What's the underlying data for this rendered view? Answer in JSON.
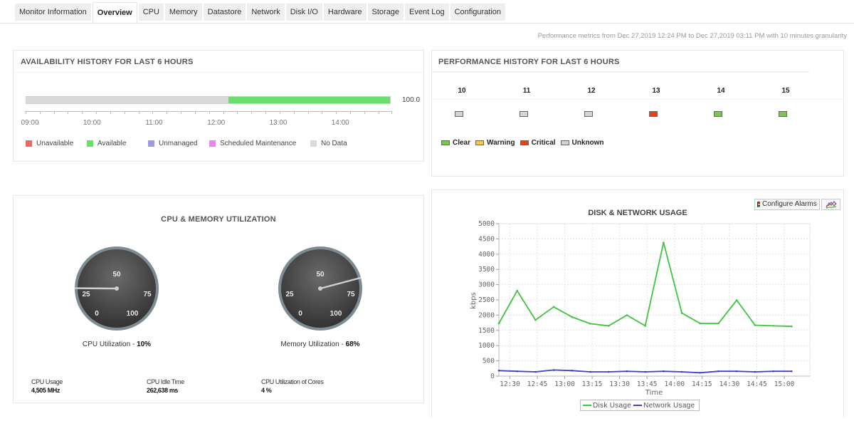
{
  "tabs": [
    {
      "label": "Monitor Information",
      "active": false
    },
    {
      "label": "Overview",
      "active": true
    },
    {
      "label": "CPU",
      "active": false
    },
    {
      "label": "Memory",
      "active": false
    },
    {
      "label": "Datastore",
      "active": false
    },
    {
      "label": "Network",
      "active": false
    },
    {
      "label": "Disk I/O",
      "active": false
    },
    {
      "label": "Hardware",
      "active": false
    },
    {
      "label": "Storage",
      "active": false
    },
    {
      "label": "Event Log",
      "active": false
    },
    {
      "label": "Configuration",
      "active": false
    }
  ],
  "perf_note": "Performance metrics from Dec 27,2019 12:24 PM to Dec 27,2019 03:11 PM with 10 minutes granularity",
  "availability": {
    "title": "AVAILABILITY HISTORY FOR LAST 6 HOURS",
    "value_label": "100.0",
    "segments": [
      {
        "status": "No Data",
        "start": "09:00",
        "end": "12:16"
      },
      {
        "status": "Available",
        "start": "12:16",
        "end": "14:53"
      }
    ],
    "range_hours": [
      9.0,
      14.88
    ],
    "axis_labels": [
      "09:00",
      "10:00",
      "11:00",
      "12:00",
      "13:00",
      "14:00"
    ],
    "legend": [
      {
        "label": "Unavailable",
        "color": "#e86a6a"
      },
      {
        "label": "Available",
        "color": "#6ae06a"
      },
      {
        "label": "Unmanaged",
        "color": "#9b9be0"
      },
      {
        "label": "Scheduled Maintenance",
        "color": "#e888e8"
      },
      {
        "label": "No Data",
        "color": "#dadada"
      }
    ]
  },
  "performance": {
    "title": "PERFORMANCE HISTORY FOR LAST 6 HOURS",
    "hours": [
      {
        "hour": "10",
        "status": "Unknown"
      },
      {
        "hour": "11",
        "status": "Unknown"
      },
      {
        "hour": "12",
        "status": "Unknown"
      },
      {
        "hour": "13",
        "status": "Critical"
      },
      {
        "hour": "14",
        "status": "Clear"
      },
      {
        "hour": "15",
        "status": "Clear"
      }
    ],
    "legend": [
      {
        "label": "Clear",
        "color": "#7ac74f"
      },
      {
        "label": "Warning",
        "color": "#f5c84c"
      },
      {
        "label": "Critical",
        "color": "#e8401c"
      },
      {
        "label": "Unknown",
        "color": "#d4d4d4"
      }
    ]
  },
  "cpu_memory": {
    "title": "CPU & MEMORY UTILIZATION",
    "gauges": [
      {
        "name": "cpu",
        "caption": "CPU Utilization - ",
        "value_text": "10%",
        "value": 10,
        "ticks": [
          "0",
          "25",
          "50",
          "75",
          "100"
        ]
      },
      {
        "name": "memory",
        "caption": "Memory Utilization - ",
        "value_text": "68%",
        "value": 68,
        "ticks": [
          "0",
          "25",
          "50",
          "75",
          "100"
        ]
      }
    ],
    "stats": [
      {
        "label": "CPU Usage",
        "value": "4,505 MHz"
      },
      {
        "label": "CPU Idle Time",
        "value": "262,638 ms"
      },
      {
        "label": "CPU Utilization of Cores",
        "value": "4 %"
      }
    ]
  },
  "disk_network": {
    "configure_alarms_label": "Configure Alarms",
    "chart_type_icon": "line-chart-icon"
  },
  "chart_data": {
    "type": "line",
    "title": "DISK & NETWORK USAGE",
    "xlabel": "Time",
    "ylabel": "kbps",
    "ylim": [
      0,
      5000
    ],
    "yticks": [
      "0",
      "500",
      "1000",
      "1500",
      "2000",
      "2500",
      "3000",
      "3500",
      "4000",
      "4500",
      "5000"
    ],
    "xticks": [
      "12:30",
      "12:45",
      "13:00",
      "13:15",
      "13:30",
      "13:45",
      "14:00",
      "14:15",
      "14:30",
      "14:45",
      "15:00"
    ],
    "x": [
      "12:24",
      "12:34",
      "12:44",
      "12:54",
      "13:04",
      "13:14",
      "13:24",
      "13:34",
      "13:44",
      "13:54",
      "14:04",
      "14:14",
      "14:24",
      "14:34",
      "14:44",
      "14:54",
      "15:04"
    ],
    "x_minutes_range": [
      744,
      914
    ],
    "grid": true,
    "legend_position": "bottom",
    "series": [
      {
        "name": "Disk Usage",
        "color": "#3fc43f",
        "values": [
          1730,
          2800,
          1840,
          2270,
          1940,
          1720,
          1650,
          2000,
          1650,
          4380,
          2070,
          1730,
          1730,
          2490,
          1670,
          1650,
          1630
        ]
      },
      {
        "name": "Network Usage",
        "color": "#4040c8",
        "values": [
          180,
          160,
          140,
          200,
          180,
          140,
          140,
          160,
          140,
          160,
          140,
          110,
          160,
          160,
          140,
          160,
          160
        ]
      }
    ]
  }
}
